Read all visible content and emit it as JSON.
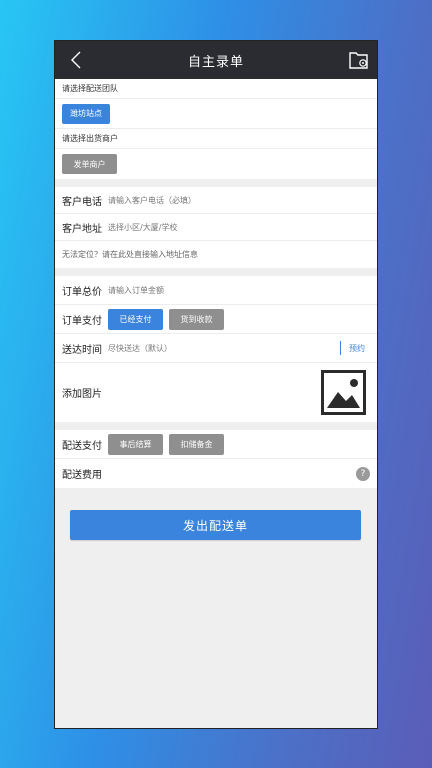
{
  "header": {
    "title": "自主录单",
    "back_icon": "chevron-left-icon",
    "folder_icon": "folder-settings-icon"
  },
  "team": {
    "label": "请选择配送团队",
    "button": "潍坊站点"
  },
  "merchant": {
    "label": "请选择出货商户",
    "button": "发单商户"
  },
  "customer": {
    "phone_label": "客户电话",
    "phone_placeholder": "请输入客户电话（必填）",
    "address_label": "客户地址",
    "address_placeholder": "选择小区/大厦/学校",
    "locate_hint": "无法定位？请在此处直接输入地址信息"
  },
  "order": {
    "total_label": "订单总价",
    "total_placeholder": "请输入订单金额",
    "payment_label": "订单支付",
    "payment_options": [
      "已经支付",
      "货到收款"
    ],
    "payment_selected": "已经支付",
    "time_label": "送达时间",
    "time_value": "尽快送达（默认）",
    "reserve": "预约",
    "image_label": "添加图片",
    "image_icon": "image-placeholder-icon"
  },
  "delivery": {
    "pay_label": "配送支付",
    "pay_options": [
      "事后结算",
      "扣储备金"
    ],
    "fee_label": "配送费用",
    "help_icon": "?"
  },
  "submit_label": "发出配送单",
  "colors": {
    "accent": "#3a84dd",
    "topbar": "#2b2c31",
    "inactive_button": "#8f8f8f"
  }
}
